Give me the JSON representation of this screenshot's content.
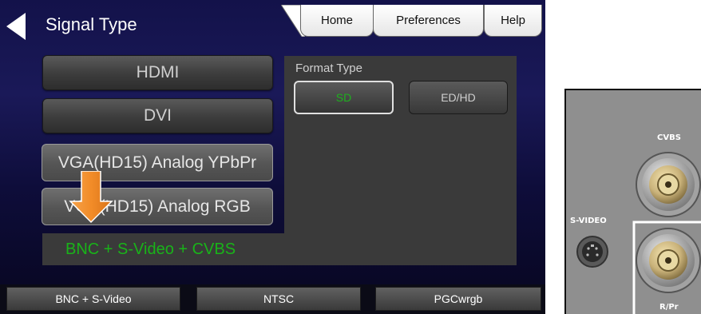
{
  "header": {
    "title": "Signal Type"
  },
  "tabs": [
    {
      "label": "Home"
    },
    {
      "label": "Preferences"
    },
    {
      "label": "Help"
    }
  ],
  "signal_buttons": [
    {
      "label": "HDMI"
    },
    {
      "label": "DVI"
    },
    {
      "label": "VGA(HD15) Analog YPbPr"
    },
    {
      "label": "VGA(HD15) Analog RGB"
    }
  ],
  "selected_signal": {
    "label": "BNC + S-Video + CVBS"
  },
  "format": {
    "label": "Format Type",
    "options": [
      {
        "label": "SD",
        "selected": true
      },
      {
        "label": "ED/HD",
        "selected": false
      }
    ]
  },
  "status_bar": [
    {
      "label": "BNC + S-Video"
    },
    {
      "label": "NTSC"
    },
    {
      "label": "PGCwrgb"
    }
  ],
  "photo_labels": {
    "cvbs": "CVBS",
    "svideo": "S-VIDEO",
    "rpr": "R/Pr"
  },
  "colors": {
    "accent_green": "#1db01d",
    "arrow_orange": "#f28c28",
    "screen_bg": "#13124a"
  }
}
